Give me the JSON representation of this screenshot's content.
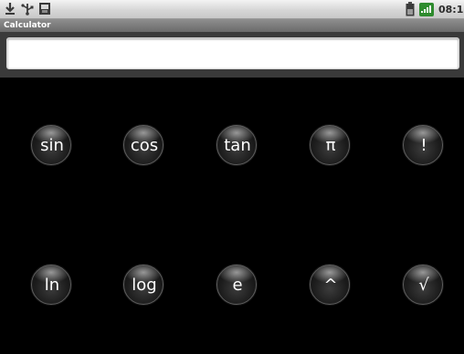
{
  "status_bar": {
    "left_icons": [
      "download-icon",
      "usb-icon",
      "sd-card-icon"
    ],
    "right_icons": [
      "battery-icon",
      "signal-icon"
    ],
    "time": "08:1"
  },
  "title_bar": {
    "title": "Calculator"
  },
  "display": {
    "value": "",
    "placeholder": ""
  },
  "keypad": {
    "keys": [
      {
        "label": "sin",
        "name": "sin-key"
      },
      {
        "label": "cos",
        "name": "cos-key"
      },
      {
        "label": "tan",
        "name": "tan-key"
      },
      {
        "label": "π",
        "name": "pi-key"
      },
      {
        "label": "!",
        "name": "factorial-key"
      },
      {
        "label": "ln",
        "name": "ln-key"
      },
      {
        "label": "log",
        "name": "log-key"
      },
      {
        "label": "e",
        "name": "e-key"
      },
      {
        "label": "^",
        "name": "power-key"
      },
      {
        "label": "√",
        "name": "sqrt-key"
      }
    ]
  },
  "colors": {
    "background": "#000000",
    "status_bar": "#d6d6d6",
    "title_bar": "#7a7a7a",
    "display_field": "#ffffff",
    "key_text": "#ffffff"
  }
}
